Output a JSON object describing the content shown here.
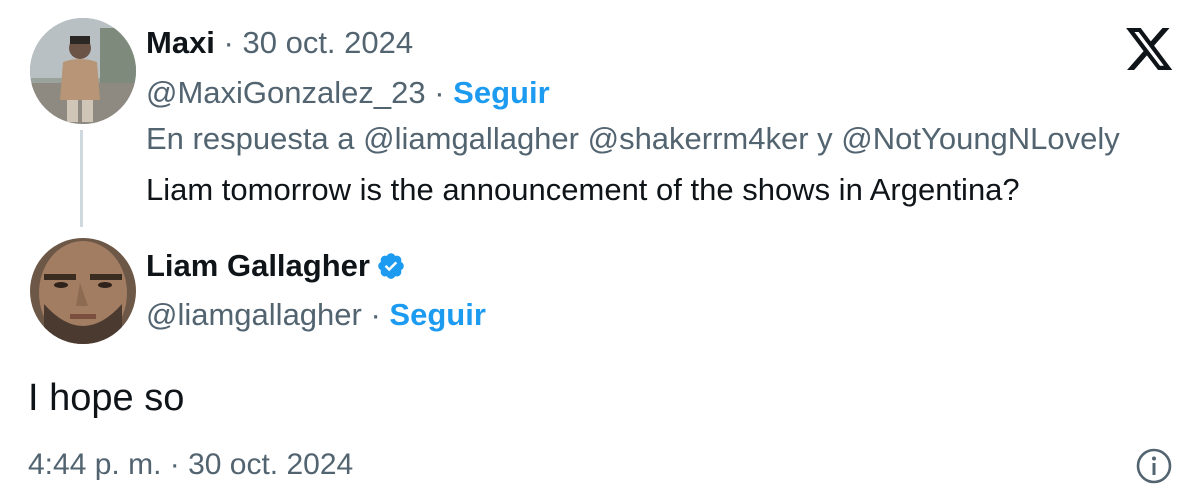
{
  "parent_tweet": {
    "author_name": "Maxi",
    "separator": " · ",
    "date": "30 oct. 2024",
    "handle": "@MaxiGonzalez_23",
    "follow_label": "Seguir",
    "reply_to_text": "En respuesta a @liamgallagher @shakerrm4ker y @NotYoungNLovely",
    "text": "Liam tomorrow is the announcement of the shows in Argentina?"
  },
  "main_tweet": {
    "author_name": "Liam Gallagher",
    "handle": "@liamgallagher",
    "separator": " · ",
    "follow_label": "Seguir",
    "text": "I hope so",
    "timestamp": "4:44 p. m. · 30 oct. 2024",
    "verified": true
  },
  "icons": {
    "brand": "x-logo-icon",
    "verified": "verified-badge-icon",
    "info": "info-icon"
  },
  "colors": {
    "accent": "#1d9bf0",
    "text": "#0f1419",
    "muted": "#536471",
    "thread_line": "#cfd9de"
  }
}
